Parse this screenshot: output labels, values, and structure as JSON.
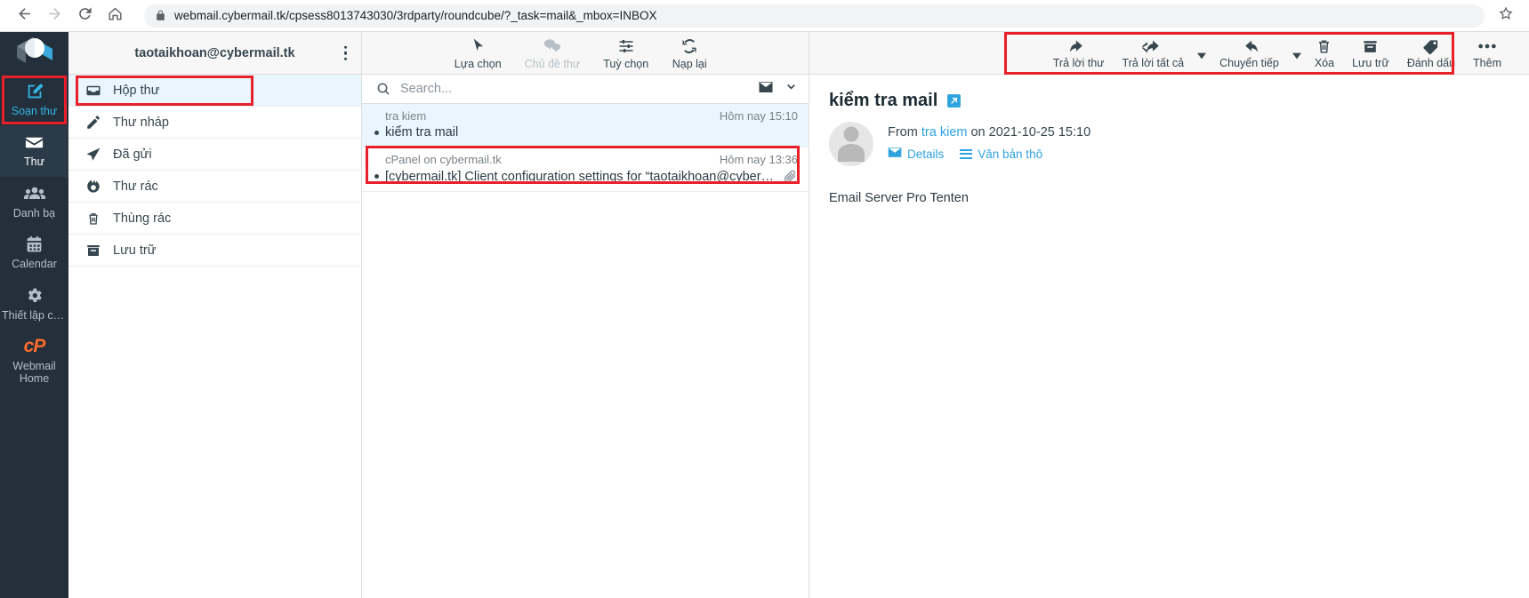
{
  "browser": {
    "back_icon": "arrow-left-icon",
    "forward_icon": "arrow-right-icon",
    "reload_icon": "reload-icon",
    "home_icon": "home-icon",
    "lock_icon": "lock-icon",
    "url": "webmail.cybermail.tk/cpsess8013743030/3rdparty/roundcube/?_task=mail&_mbox=INBOX",
    "star_icon": "star-icon"
  },
  "taskbar": {
    "logo_icon": "cpanel-cube-logo",
    "items": [
      {
        "label": "Soạn thư",
        "icon": "compose-pencil-icon",
        "state": "highlighted"
      },
      {
        "label": "Thư",
        "icon": "envelope-icon",
        "state": "selected"
      },
      {
        "label": "Danh bạ",
        "icon": "contacts-icon",
        "state": "normal"
      },
      {
        "label": "Calendar",
        "icon": "calendar-icon",
        "state": "normal"
      },
      {
        "label": "Thiết lập cấ...",
        "icon": "gear-icon",
        "state": "normal"
      },
      {
        "label": "Webmail Home",
        "icon": "cpanel-logo-icon",
        "state": "normal"
      }
    ]
  },
  "folders": {
    "account": "taotaikhoan@cybermail.tk",
    "menu_icon": "kebab-menu-icon",
    "items": [
      {
        "label": "Hộp thư",
        "icon": "inbox-icon",
        "active": true
      },
      {
        "label": "Thư nháp",
        "icon": "pencil-icon",
        "active": false
      },
      {
        "label": "Đã gửi",
        "icon": "paper-plane-icon",
        "active": false
      },
      {
        "label": "Thư rác",
        "icon": "fire-icon",
        "active": false
      },
      {
        "label": "Thùng rác",
        "icon": "trash-icon",
        "active": false
      },
      {
        "label": "Lưu trữ",
        "icon": "archive-icon",
        "active": false
      }
    ]
  },
  "list_toolbar": {
    "buttons": [
      {
        "label": "Lựa chọn",
        "icon": "cursor-icon",
        "disabled": false
      },
      {
        "label": "Chủ đề thư",
        "icon": "threads-icon",
        "disabled": true
      },
      {
        "label": "Tuỳ chọn",
        "icon": "sliders-icon",
        "disabled": false
      },
      {
        "label": "Nạp lại",
        "icon": "refresh-icon",
        "disabled": false
      }
    ]
  },
  "search": {
    "icon": "search-icon",
    "placeholder": "Search...",
    "value": "",
    "scope_icon": "envelope-icon",
    "chevron_icon": "chevron-down-icon"
  },
  "messages": [
    {
      "from": "tra kiem",
      "date": "Hôm nay 15:10",
      "subject": "kiểm tra mail",
      "unread": true,
      "attachment": false,
      "selected": true
    },
    {
      "from": "cPanel on cybermail.tk",
      "date": "Hôm nay 13:36",
      "subject": "[cybermail.tk] Client configuration settings for “taotaikhoan@cyberm…",
      "unread": true,
      "attachment": true,
      "selected": false
    }
  ],
  "preview_toolbar": {
    "buttons": [
      {
        "label": "Trả lời thư",
        "icon": "reply-icon",
        "caret": false
      },
      {
        "label": "Trả lời tất cả",
        "icon": "reply-all-icon",
        "caret": true
      },
      {
        "label": "Chuyển tiếp",
        "icon": "forward-icon",
        "caret": true
      },
      {
        "label": "Xóa",
        "icon": "trash-icon",
        "caret": false
      },
      {
        "label": "Lưu trữ",
        "icon": "archive-icon",
        "caret": false
      },
      {
        "label": "Đánh dấu",
        "icon": "tag-icon",
        "caret": false
      },
      {
        "label": "Thêm",
        "icon": "more-dots-icon",
        "caret": false
      }
    ]
  },
  "preview": {
    "subject": "kiểm tra mail",
    "open_icon": "external-link-icon",
    "avatar_icon": "user-avatar-icon",
    "from_prefix": "From",
    "from_name": "tra kiem",
    "from_middle": "on",
    "from_date": "2021-10-25 15:10",
    "details_label": "Details",
    "details_icon": "envelope-icon",
    "plaintext_label": "Văn bản thô",
    "plaintext_icon": "lines-icon",
    "body": "Email Server Pro Tenten"
  },
  "colors": {
    "accent": "#2fa3e0",
    "highlight": "#e8202a",
    "rail": "#232f3b",
    "selection": "#eaf6fd",
    "cpanel_orange": "#ff6c2c"
  }
}
